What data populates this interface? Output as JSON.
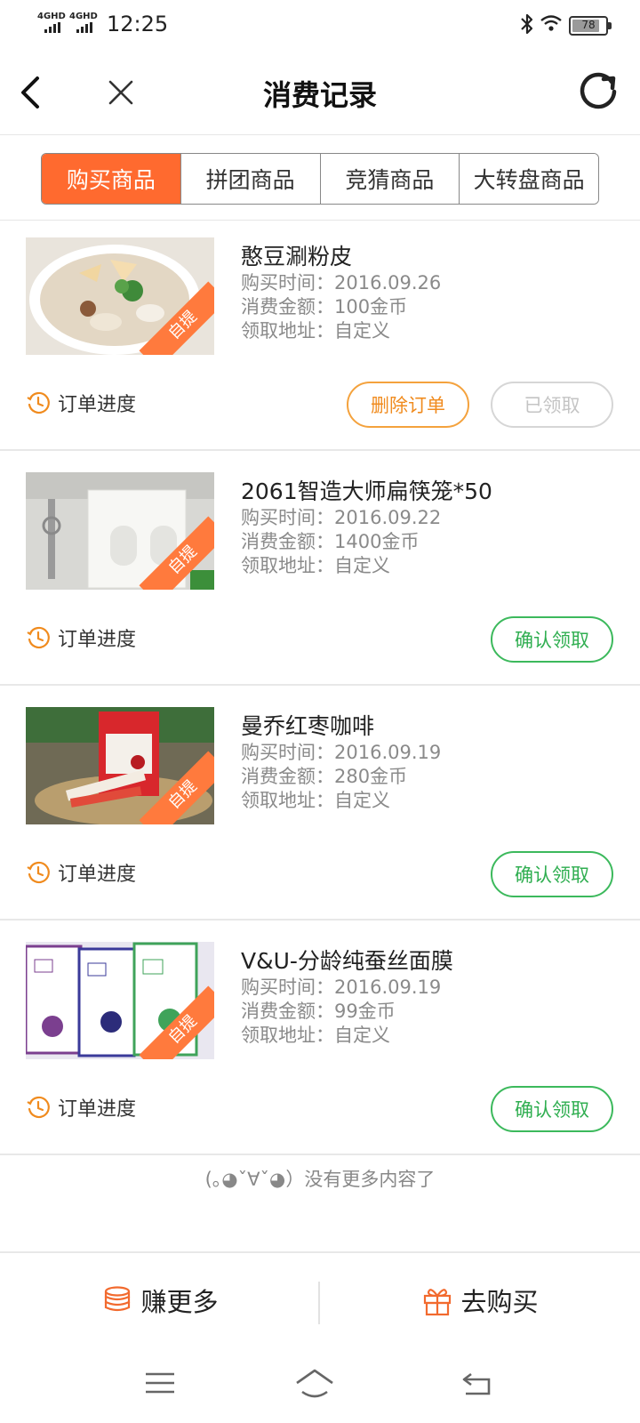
{
  "status_bar": {
    "signal1": "4GHD",
    "signal2": "4GHD",
    "time": "12:25",
    "battery": "78"
  },
  "header": {
    "title": "消费记录",
    "icons": [
      "back-arrow-icon",
      "close-icon",
      "refresh-icon"
    ]
  },
  "tabs": [
    {
      "label": "购买商品",
      "active": true
    },
    {
      "label": "拼团商品",
      "active": false
    },
    {
      "label": "竞猜商品",
      "active": false
    },
    {
      "label": "大转盘商品",
      "active": false
    }
  ],
  "order_labels": {
    "time": "购买时间：",
    "amount": "消费金额：",
    "address": "领取地址：",
    "progress": "订单进度",
    "badge": "自提"
  },
  "orders": [
    {
      "name": "憨豆涮粉皮",
      "time": "2016.09.26",
      "amount": "100金币",
      "address": "自定义",
      "buttons": [
        "删除订单",
        "已领取"
      ]
    },
    {
      "name": "2061智造大师扁筷笼*50",
      "time": "2016.09.22",
      "amount": "1400金币",
      "address": "自定义",
      "buttons": [
        "确认领取"
      ]
    },
    {
      "name": "曼乔红枣咖啡",
      "time": "2016.09.19",
      "amount": "280金币",
      "address": "自定义",
      "buttons": [
        "确认领取"
      ]
    },
    {
      "name": "V&U-分龄纯蚕丝面膜",
      "time": "2016.09.19",
      "amount": "99金币",
      "address": "自定义",
      "buttons": [
        "确认领取"
      ]
    }
  ],
  "footer_note": "(｡◕ˇ∀ˇ◕）没有更多内容了",
  "bottom_bar": {
    "earn_label": "赚更多",
    "buy_label": "去购买"
  },
  "colors": {
    "accent": "#ff6a2f",
    "confirm_green": "#2fae50",
    "delete_orange": "#f08b1e",
    "muted": "#8a8a8a"
  }
}
